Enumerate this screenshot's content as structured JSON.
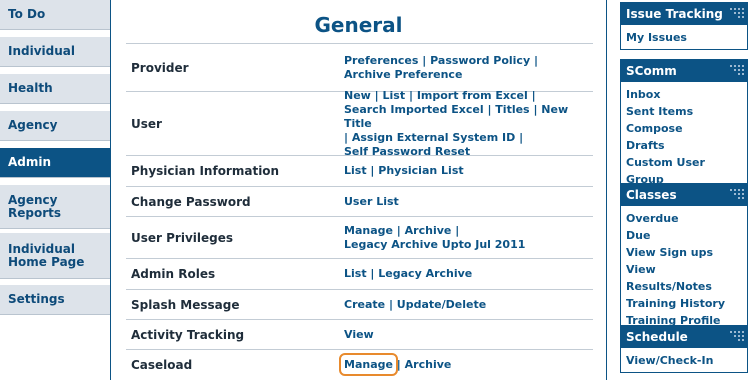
{
  "sidebar": {
    "items": [
      {
        "label": "To Do",
        "active": false
      },
      {
        "label": "Individual",
        "active": false
      },
      {
        "label": "Health",
        "active": false
      },
      {
        "label": "Agency",
        "active": false
      },
      {
        "label": "Admin",
        "active": true
      },
      {
        "label": "Agency\nReports",
        "active": false
      },
      {
        "label": "Individual\nHome Page",
        "active": false
      },
      {
        "label": "Settings",
        "active": false
      }
    ]
  },
  "main": {
    "title": "General",
    "rows": [
      {
        "label": "Provider",
        "links": [
          "Preferences",
          "Password Policy",
          "Archive Preference"
        ]
      },
      {
        "label": "User",
        "links": [
          "New",
          "List",
          "Import from Excel",
          "Search Imported Excel",
          "Titles",
          "New Title",
          "Assign External System ID",
          "Self Password Reset"
        ]
      },
      {
        "label": "Physician Information",
        "links": [
          "List",
          "Physician List"
        ]
      },
      {
        "label": "Change Password",
        "links": [
          "User List"
        ]
      },
      {
        "label": "User Privileges",
        "links": [
          "Manage",
          "Archive",
          "Legacy Archive Upto Jul 2011"
        ]
      },
      {
        "label": "Admin Roles",
        "links": [
          "List",
          "Legacy Archive"
        ]
      },
      {
        "label": "Splash Message",
        "links": [
          "Create",
          "Update/Delete"
        ]
      },
      {
        "label": "Activity Tracking",
        "links": [
          "View"
        ]
      },
      {
        "label": "Caseload",
        "links": [
          "Manage",
          "Archive"
        ]
      }
    ]
  },
  "right": {
    "boxes": [
      {
        "title": "Issue Tracking",
        "items": [
          "My Issues"
        ]
      },
      {
        "title": "SComm",
        "items": [
          "Inbox",
          "Sent Items",
          "Compose",
          "Drafts",
          "Custom User Group"
        ]
      },
      {
        "title": "Classes",
        "items": [
          "Overdue",
          "Due",
          "View Sign ups",
          "View Results/Notes",
          "Training History",
          "Training Profile"
        ]
      },
      {
        "title": "Schedule",
        "items": [
          "View/Check-In"
        ]
      }
    ]
  },
  "colors": {
    "brand": "#0c5385",
    "focus": "#e88a2d",
    "sidebar_bg": "#dde3ea"
  }
}
